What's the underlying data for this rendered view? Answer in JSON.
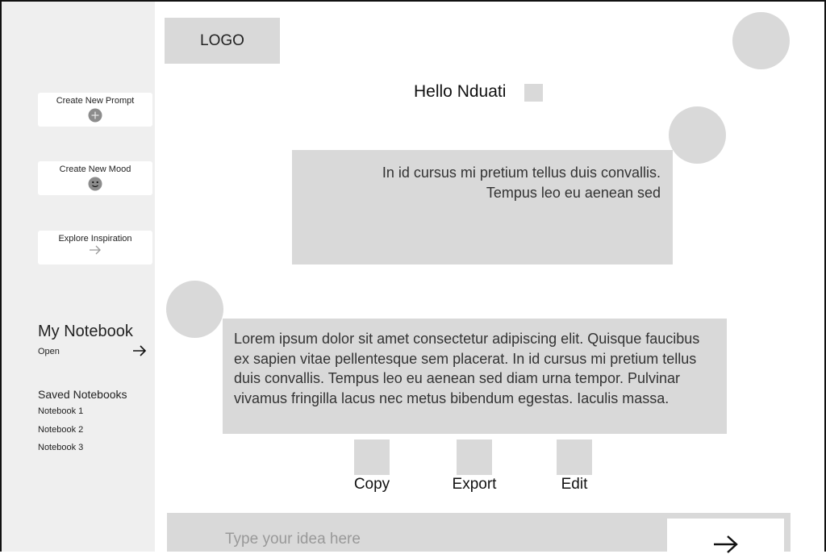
{
  "header": {
    "logo_text": "LOGO",
    "greeting": "Hello Nduati"
  },
  "sidebar": {
    "create_prompt_label": "Create New Prompt",
    "create_mood_label": "Create New Mood",
    "explore_label": "Explore Inspiration",
    "notebook_title": "My Notebook",
    "notebook_open_label": "Open",
    "saved_title": "Saved Notebooks",
    "saved_items": [
      "Notebook 1",
      "Notebook 2",
      "Notebook 3"
    ]
  },
  "chat": {
    "user_message_line1": "In id cursus mi pretium tellus duis convallis.",
    "user_message_line2": "Tempus leo eu aenean sed",
    "ai_message": "Lorem ipsum dolor sit amet consectetur adipiscing elit. Quisque faucibus ex sapien vitae pellentesque sem placerat. In id cursus mi pretium tellus duis convallis. Tempus leo eu aenean sed diam urna tempor. Pulvinar vivamus fringilla lacus nec metus bibendum egestas. Iaculis massa."
  },
  "actions": {
    "copy_label": "Copy",
    "export_label": "Export",
    "edit_label": "Edit"
  },
  "composer": {
    "placeholder": "Type your idea here"
  },
  "icons": {
    "create_prompt": "plus-circle-icon",
    "create_mood": "smiley-icon",
    "explore": "arrow-right-icon",
    "notebook_open": "arrow-right-icon",
    "send": "arrow-right-icon"
  },
  "colors": {
    "placeholder_fill": "#d9d9d9",
    "sidebar_bg": "#efefef"
  }
}
